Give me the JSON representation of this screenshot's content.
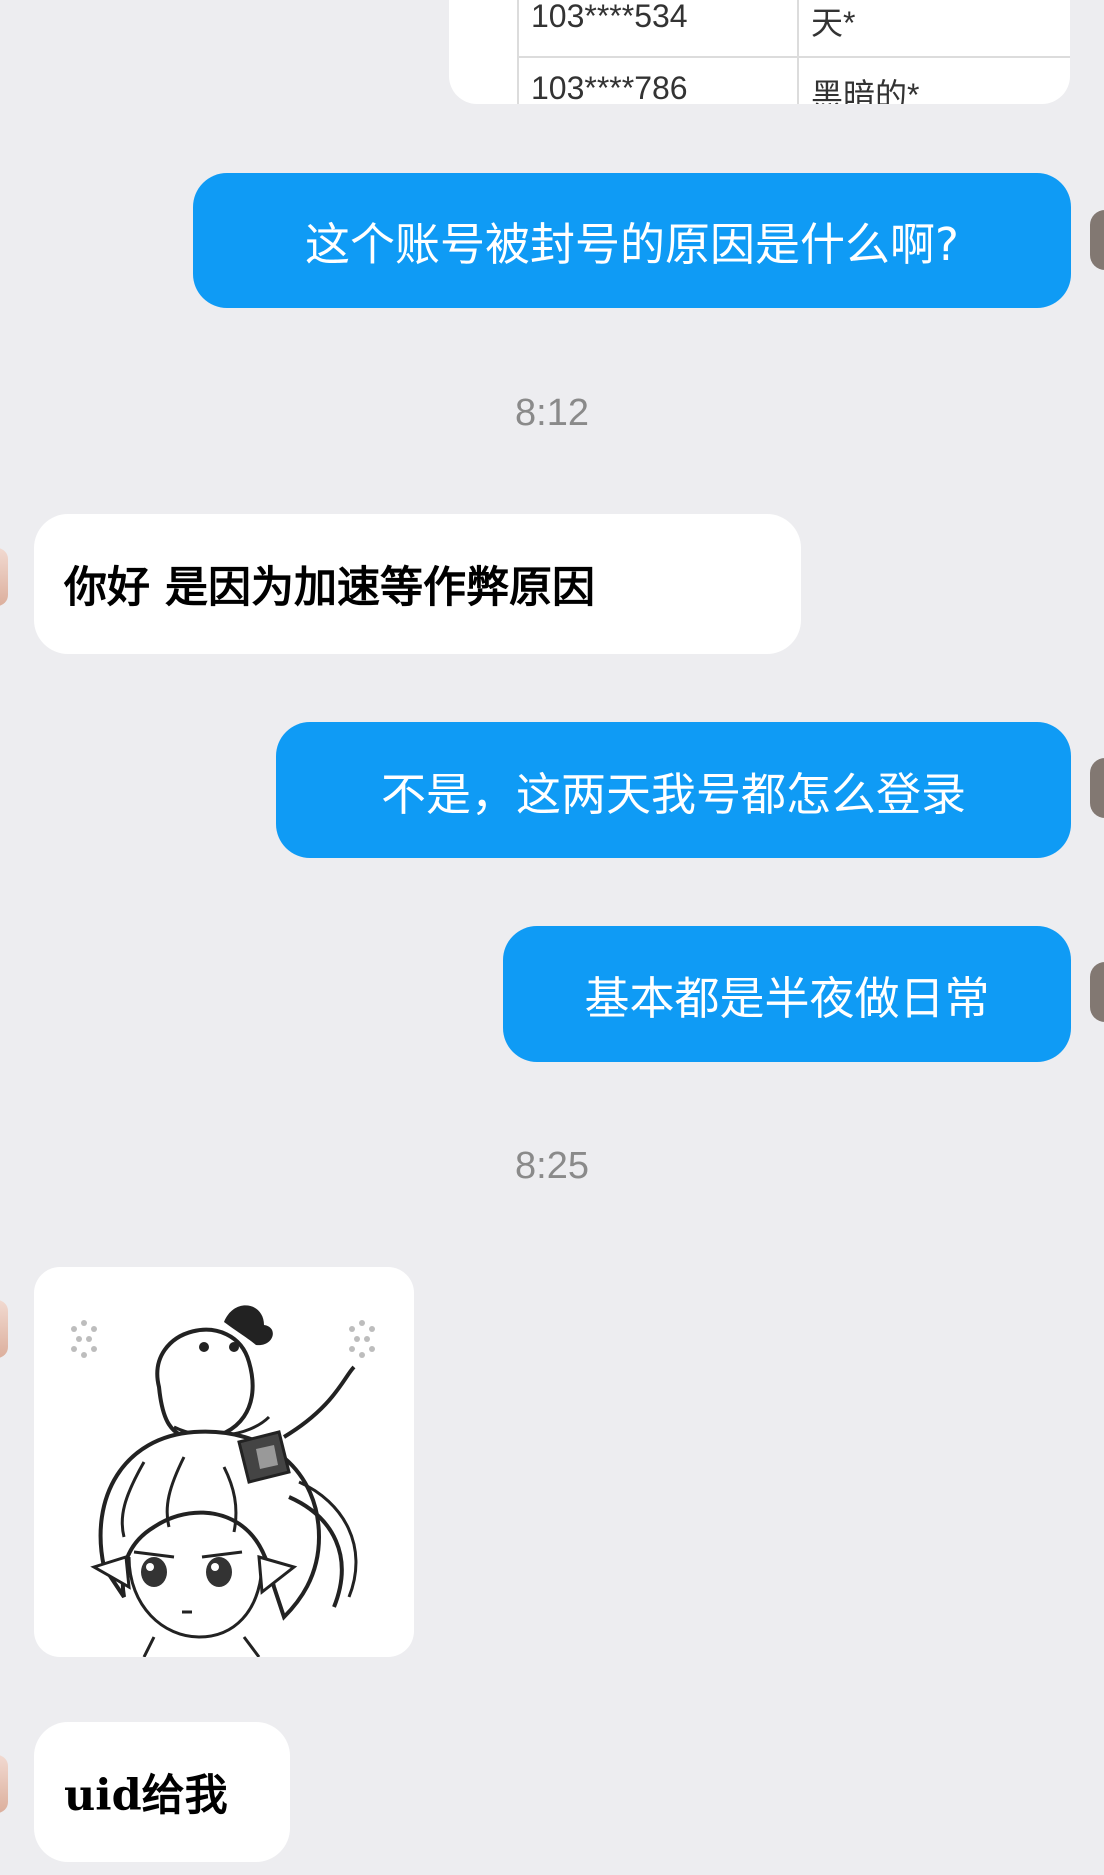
{
  "shared_table": {
    "rows": [
      {
        "id": "103****534",
        "name": "天*"
      },
      {
        "id": "103****786",
        "name": "黑暗的*"
      }
    ]
  },
  "messages": [
    {
      "side": "mine",
      "text": "这个账号被封号的原因是什么啊?"
    },
    {
      "type": "time",
      "text": "8:12"
    },
    {
      "side": "theirs",
      "text": "你好 是因为加速等作弊原因"
    },
    {
      "side": "mine",
      "text": "不是，这两天我号都怎么登录"
    },
    {
      "side": "mine",
      "text": "基本都是半夜做日常"
    },
    {
      "type": "time",
      "text": "8:25"
    },
    {
      "side": "theirs",
      "type": "sticker",
      "icon": "anime-girl-with-chick-sticker"
    },
    {
      "side": "theirs",
      "text": "uid给我"
    }
  ],
  "colors": {
    "background": "#ededf0",
    "mine_bubble": "#0f9bf5",
    "theirs_bubble": "#ffffff",
    "timestamp": "#8a8a8a"
  }
}
